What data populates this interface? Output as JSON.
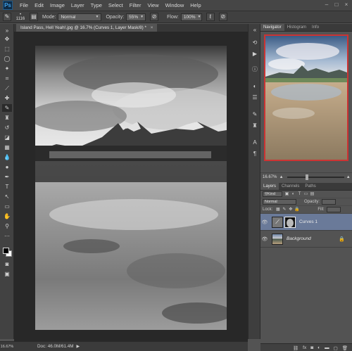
{
  "app": {
    "logo": "Ps"
  },
  "menu": [
    "File",
    "Edit",
    "Image",
    "Layer",
    "Type",
    "Select",
    "Filter",
    "View",
    "Window",
    "Help"
  ],
  "options": {
    "brush_size": "1116",
    "mode_label": "Mode:",
    "mode_value": "Normal",
    "opacity_label": "Opacity:",
    "opacity_value": "55%",
    "flow_label": "Flow:",
    "flow_value": "100%"
  },
  "document": {
    "tab_title": "Island Pass, Hell Yeah!.jpg @ 16.7% (Curves 1, Layer Mask/8) *",
    "close_glyph": "×"
  },
  "status": {
    "zoom": "16.67%",
    "doc_info": "Doc: 46.0M/61.4M"
  },
  "navigator": {
    "tabs": [
      "Navigator",
      "Histogram",
      "Info"
    ],
    "active_tab": "Navigator",
    "zoom": "16.67%"
  },
  "layers": {
    "tabs": [
      "Layers",
      "Channels",
      "Paths"
    ],
    "active_tab": "Layers",
    "kind_label": "Kind",
    "blend_mode": "Normal",
    "opacity_label": "Opacity:",
    "lock_label": "Lock:",
    "fill_label": "Fill:",
    "items": [
      {
        "name": "Curves 1",
        "selected": true,
        "italic": false
      },
      {
        "name": "Background",
        "selected": false,
        "italic": true
      }
    ],
    "footer_icons": [
      "link-icon",
      "fx-icon",
      "mask-icon",
      "adjustment-icon",
      "folder-icon",
      "new-layer-icon",
      "trash-icon"
    ]
  },
  "colors": {
    "selection": "#6a7a99",
    "nav_frame": "#cc3333",
    "ps_blue": "#3fa0e8"
  }
}
